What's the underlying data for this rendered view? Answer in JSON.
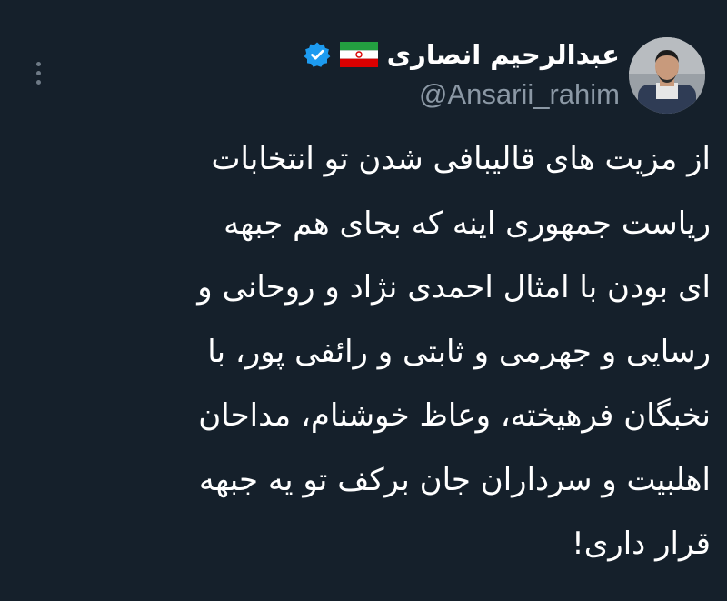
{
  "tweet": {
    "author": {
      "display_name": "عبدالرحیم انصاری",
      "handle": "@Ansarii_rahim",
      "flag_icon": "iran-flag-icon",
      "verified_icon": "verified-badge-icon"
    },
    "text_lines": [
      "از مزیت های قالیبافی شدن تو انتخابات",
      "ریاست جمهوری اینه که بجای هم جبهه",
      "ای بودن با امثال احمدی نژاد و روحانی و",
      "رسایی و جهرمی و ثابتی و رائفی پور، با",
      "نخبگان فرهیخته، وعاظ خوشنام، مداحان",
      "اهلبیت و سرداران جان برکف تو یه جبهه",
      "قرار داری!"
    ]
  },
  "colors": {
    "background": "#15202b",
    "text": "#ffffff",
    "secondary_text": "#8b98a5",
    "verified": "#1d9bf0"
  },
  "icons": {
    "more_menu": "more-vertical-icon"
  }
}
